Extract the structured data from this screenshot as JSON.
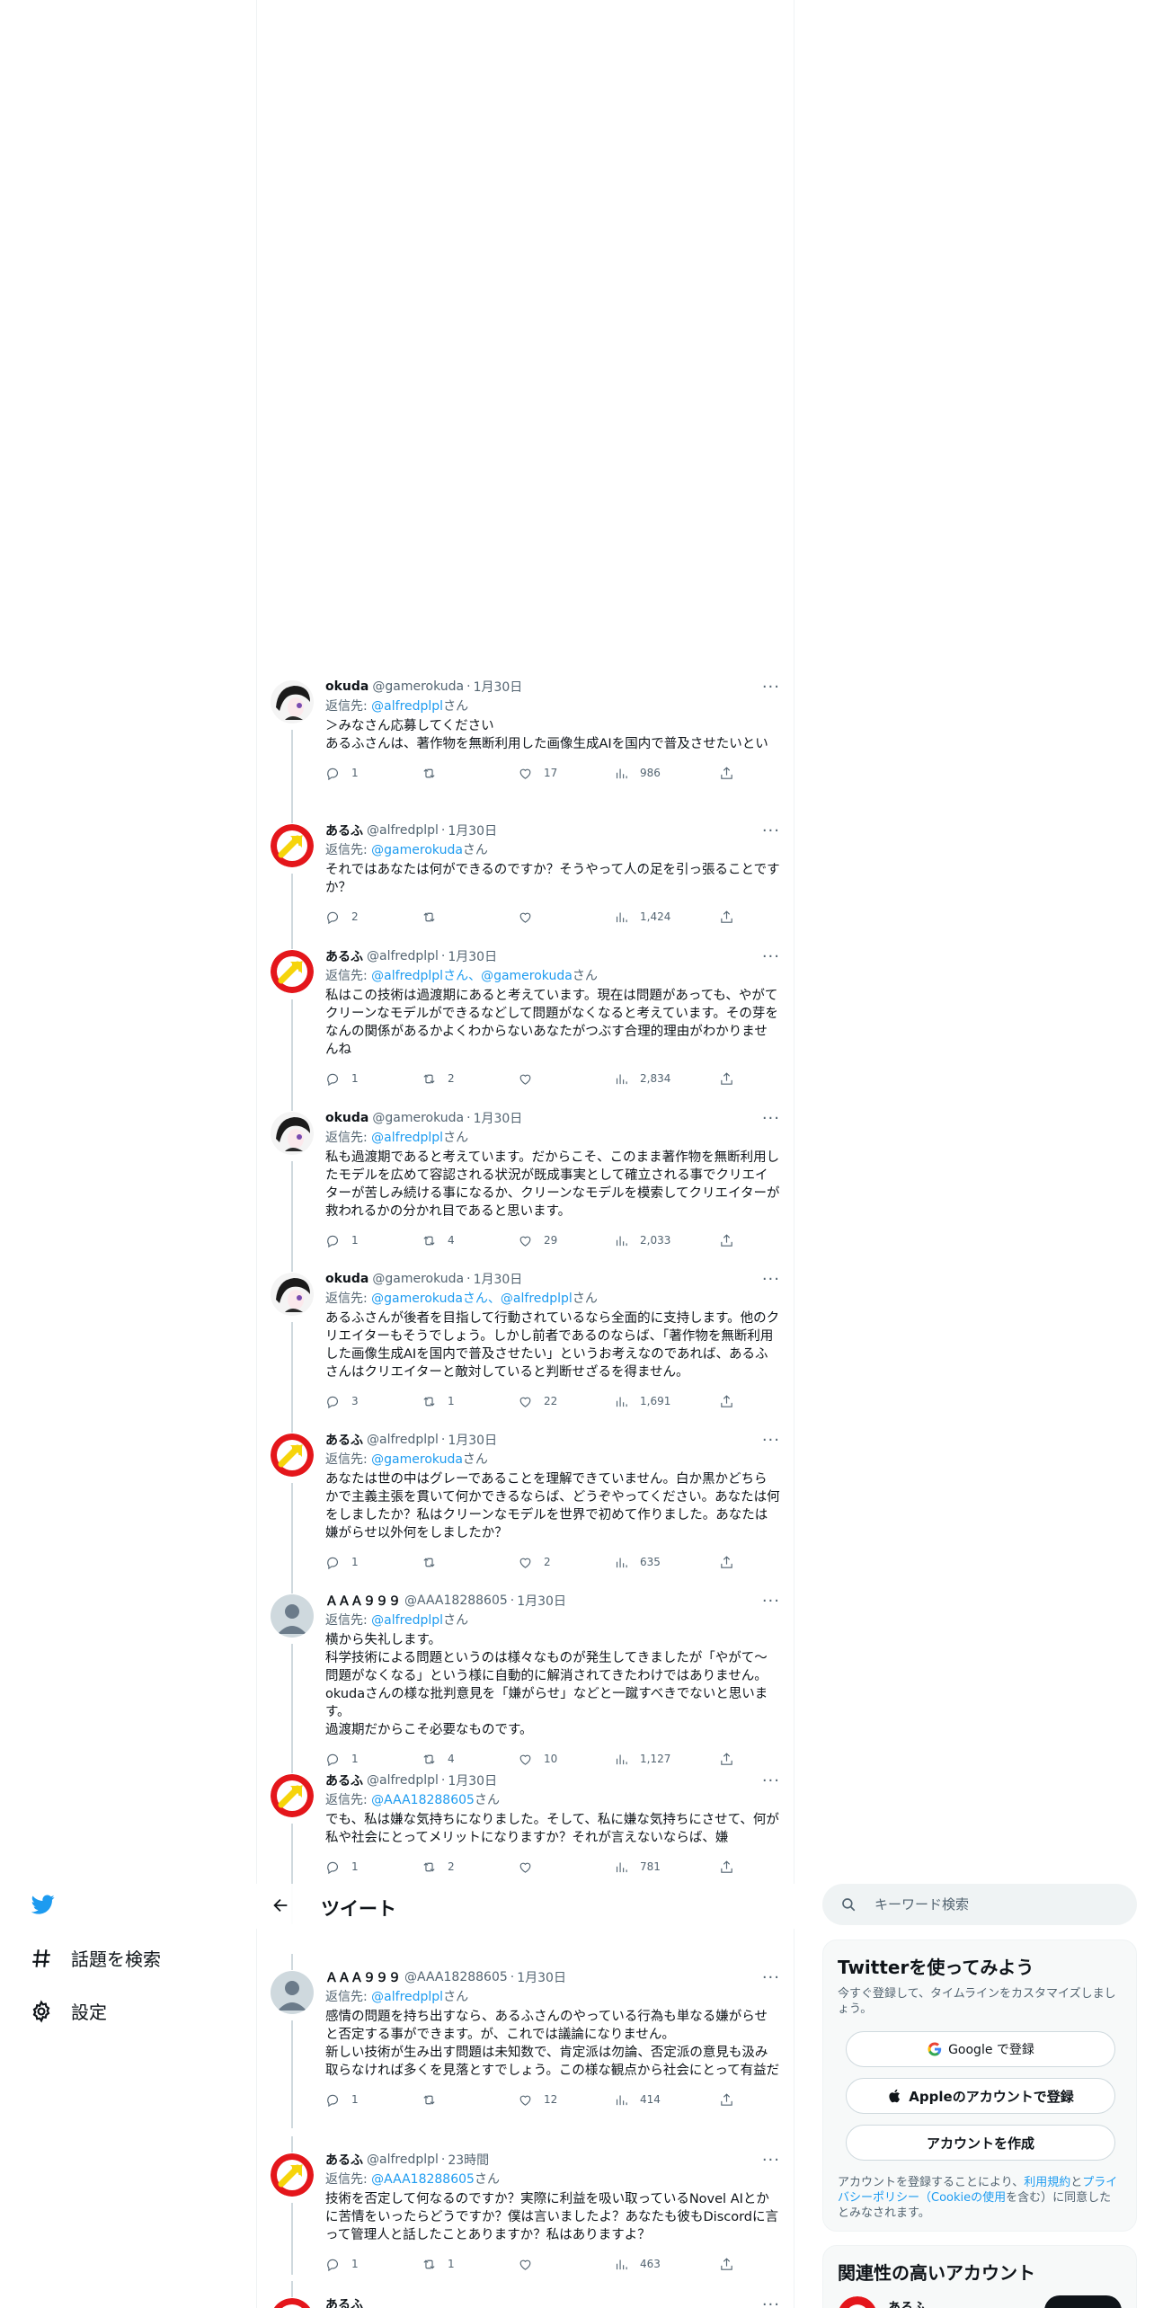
{
  "header": {
    "title": "ツイート"
  },
  "nav": {
    "explore_label": "話題を検索",
    "settings_label": "設定"
  },
  "search": {
    "placeholder": "キーワード検索"
  },
  "signup": {
    "title": "Twitterを使ってみよう",
    "subtitle": "今すぐ登録して、タイムラインをカスタマイズしましょう。",
    "google_label": "Google で登録",
    "apple_label": "Appleのアカウントで登録",
    "create_label": "アカウントを作成",
    "legal_prefix": "アカウントを登録することにより、",
    "legal_terms": "利用規約",
    "legal_and": "と",
    "legal_privacy": "プライバシーポリシー",
    "legal_cookie": "（Cookieの使用",
    "legal_suffix": "を含む）に同意したとみなされます。"
  },
  "related": {
    "title": "関連性の高いアカウント",
    "first_name": "あるふ"
  },
  "tweets": [
    {
      "avatar": "okuda",
      "name": "okuda",
      "handle": "@gamerokuda",
      "time": "1月30日",
      "reply_prefix": "返信先: ",
      "mentions": "@alfredplpl",
      "reply_suffix": "さん",
      "text": "＞みなさん応募してください\nあるふさんは、著作物を無断利用した画像生成AIを国内で普及させたいというお考えなのでしょうか。",
      "replies": "1",
      "retweets": "",
      "likes": "17",
      "views": "986"
    },
    {
      "avatar": "alfu",
      "name": "あるふ",
      "handle": "@alfredplpl",
      "time": "1月30日",
      "reply_prefix": "返信先: ",
      "mentions": "@gamerokuda",
      "reply_suffix": "さん",
      "text": "それではあなたは何ができるのですか？そうやって人の足を引っ張ることですか？",
      "replies": "2",
      "retweets": "",
      "likes": "",
      "views": "1,424"
    },
    {
      "avatar": "alfu",
      "name": "あるふ",
      "handle": "@alfredplpl",
      "time": "1月30日",
      "reply_prefix": "返信先: ",
      "mentions": "@alfredplplさん、@gamerokuda",
      "reply_suffix": "さん",
      "text": "私はこの技術は過渡期にあると考えています。現在は問題があっても、やがてクリーンなモデルができるなどして問題がなくなると考えています。その芽をなんの関係があるかよくわからないあなたがつぶす合理的理由がわかりませんね",
      "replies": "1",
      "retweets": "2",
      "likes": "",
      "views": "2,834"
    },
    {
      "avatar": "okuda",
      "name": "okuda",
      "handle": "@gamerokuda",
      "time": "1月30日",
      "reply_prefix": "返信先: ",
      "mentions": "@alfredplpl",
      "reply_suffix": "さん",
      "text": "私も過渡期であると考えています。だからこそ、このまま著作物を無断利用したモデルを広めて容認される状況が既成事実として確立される事でクリエイターが苦しみ続ける事になるか、クリーンなモデルを模索してクリエイターが救われるかの分かれ目であると思います。",
      "replies": "1",
      "retweets": "4",
      "likes": "29",
      "views": "2,033"
    },
    {
      "avatar": "okuda",
      "name": "okuda",
      "handle": "@gamerokuda",
      "time": "1月30日",
      "reply_prefix": "返信先: ",
      "mentions": "@gamerokudaさん、@alfredplpl",
      "reply_suffix": "さん",
      "text": "あるふさんが後者を目指して行動されているなら全面的に支持します。他のクリエイターもそうでしょう。しかし前者であるのならば、「著作物を無断利用した画像生成AIを国内で普及させたい」というお考えなのであれば、あるふさんはクリエイターと敵対していると判断せざるを得ません。",
      "replies": "3",
      "retweets": "1",
      "likes": "22",
      "views": "1,691"
    },
    {
      "avatar": "alfu",
      "name": "あるふ",
      "handle": "@alfredplpl",
      "time": "1月30日",
      "reply_prefix": "返信先: ",
      "mentions": "@gamerokuda",
      "reply_suffix": "さん",
      "text": "あなたは世の中はグレーであることを理解できていません。白か黒かどちらかで主義主張を貫いて何かできるならば、どうぞやってください。あなたは何をしましたか？私はクリーンなモデルを世界で初めて作りました。あなたは嫌がらせ以外何をしましたか？",
      "replies": "1",
      "retweets": "",
      "likes": "2",
      "views": "635"
    },
    {
      "avatar": "default",
      "name": "ＡＡＡ９９９",
      "handle": "@AAA18288605",
      "time": "1月30日",
      "reply_prefix": "返信先: ",
      "mentions": "@alfredplpl",
      "reply_suffix": "さん",
      "text": "横から失礼します。\n科学技術による問題というのは様々なものが発生してきましたが「やがて〜問題がなくなる」という様に自動的に解消されてきたわけではありません。\nokudaさんの様な批判意見を「嫌がらせ」などと一蹴すべきでないと思います。\n過渡期だからこそ必要なものです。",
      "replies": "1",
      "retweets": "4",
      "likes": "10",
      "views": "1,127"
    },
    {
      "avatar": "alfu",
      "name": "あるふ",
      "handle": "@alfredplpl",
      "time": "1月30日",
      "reply_prefix": "返信先: ",
      "mentions": "@AAA18288605",
      "reply_suffix": "さん",
      "text": "でも、私は嫌な気持ちになりました。そして、私に嫌な気持ちにさせて、何が私や社会にとってメリットになりますか？それが言えないならば、嫌",
      "replies": "1",
      "retweets": "2",
      "likes": "",
      "views": "781"
    },
    {
      "avatar": "default",
      "name": "ＡＡＡ９９９",
      "handle": "@AAA18288605",
      "time": "1月30日",
      "reply_prefix": "返信先: ",
      "mentions": "@alfredplpl",
      "reply_suffix": "さん",
      "text": "感情の問題を持ち出すなら、あるふさんのやっている行為も単なる嫌がらせと否定する事ができます。が、これでは議論になりません。\n新しい技術が生み出す問題は未知数で、肯定派は勿論、否定派の意見も汲み取らなければ多くを見落とすでしょう。この様な観点から社会にとって有益だと考えられます。",
      "replies": "1",
      "retweets": "",
      "likes": "12",
      "views": "414"
    },
    {
      "avatar": "alfu",
      "name": "あるふ",
      "handle": "@alfredplpl",
      "time": "23時間",
      "reply_prefix": "返信先: ",
      "mentions": "@AAA18288605",
      "reply_suffix": "さん",
      "text": "技術を否定して何なるのですか？実際に利益を吸い取っているNovel AIとかに苦情をいったらどうですか？僕は言いましたよ？あなたも彼もDiscordに言って管理人と話したことありますか？私はありますよ？",
      "replies": "1",
      "retweets": "1",
      "likes": "",
      "views": "463"
    },
    {
      "avatar": "alfu",
      "name": "あるふ",
      "handle": "",
      "time": "",
      "reply_prefix": "",
      "mentions": "",
      "reply_suffix": "",
      "text": "",
      "replies": "",
      "retweets": "",
      "likes": "",
      "views": ""
    }
  ]
}
